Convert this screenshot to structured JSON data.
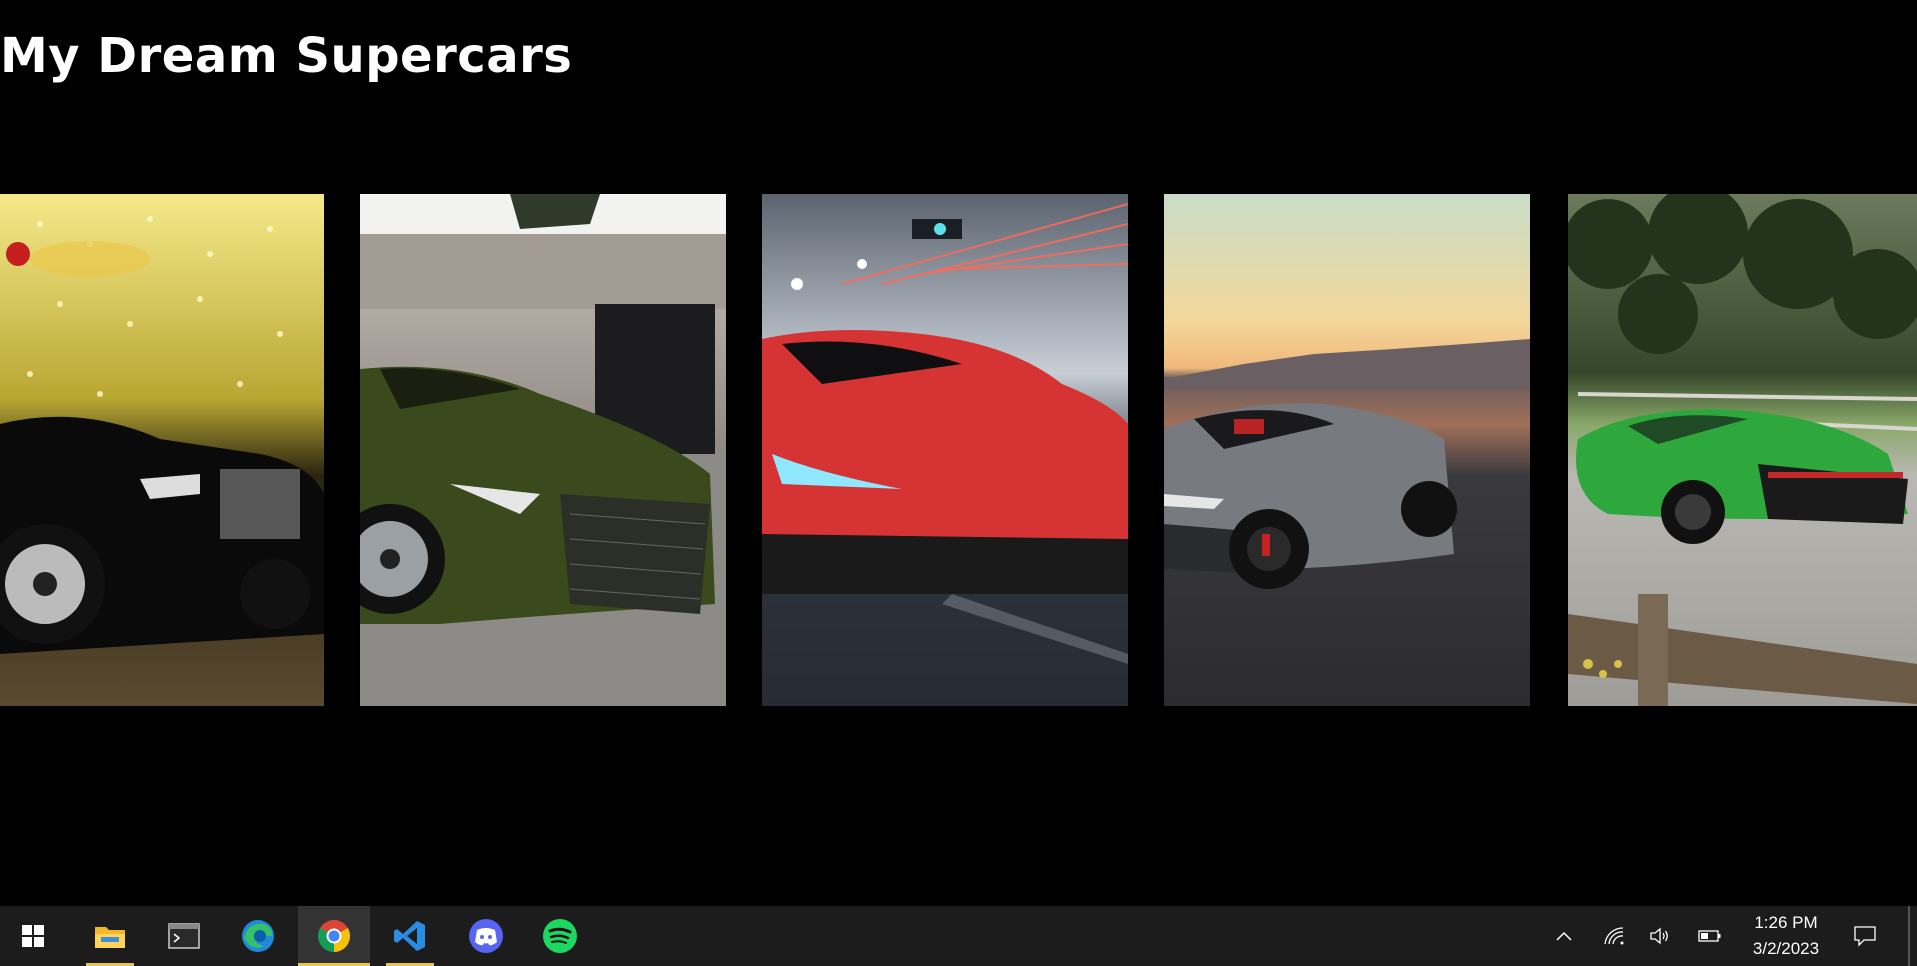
{
  "page": {
    "title": "My Dream Supercars"
  },
  "gallery": {
    "cars": [
      {
        "name": "rolls-royce-black",
        "color": "#0b0b0b",
        "backdrop": "#c9b84a"
      },
      {
        "name": "lexus-lc-green",
        "color": "#3b4a1e",
        "backdrop": "#8a8580"
      },
      {
        "name": "mclaren-red",
        "color": "#d83a3a",
        "backdrop": "#6b7380"
      },
      {
        "name": "acura-nsx-grey",
        "color": "#6e7176",
        "backdrop": "#f0c98a"
      },
      {
        "name": "bugatti-green",
        "color": "#2aa83a",
        "backdrop": "#3e5a2a"
      }
    ]
  },
  "taskbar": {
    "apps": [
      {
        "name": "windows-start-icon",
        "active": false,
        "open": false
      },
      {
        "name": "file-explorer-icon",
        "active": false,
        "open": true
      },
      {
        "name": "terminal-icon",
        "active": false,
        "open": false
      },
      {
        "name": "edge-icon",
        "active": false,
        "open": false
      },
      {
        "name": "chrome-icon",
        "active": true,
        "open": true
      },
      {
        "name": "vscode-icon",
        "active": false,
        "open": true
      },
      {
        "name": "discord-icon",
        "active": false,
        "open": false
      },
      {
        "name": "spotify-icon",
        "active": false,
        "open": false
      }
    ],
    "tray": {
      "icons": [
        "chevron-up-icon",
        "wifi-icon",
        "volume-icon",
        "battery-icon"
      ],
      "time": "1:26 PM",
      "date": "3/2/2023"
    },
    "accent": "#e8c54a"
  }
}
